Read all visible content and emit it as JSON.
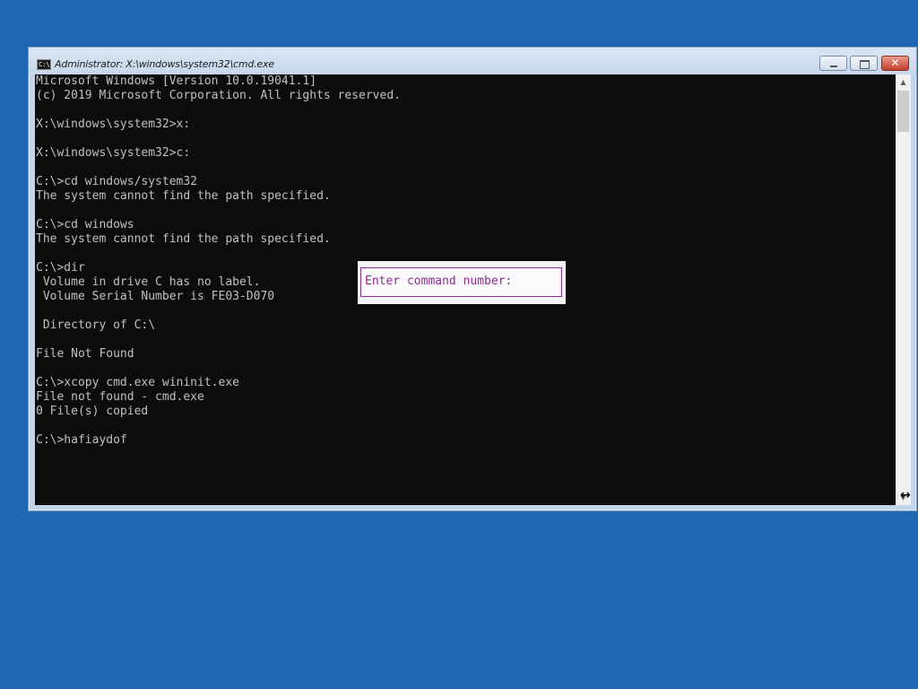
{
  "window": {
    "title": "Administrator: X:\\windows\\system32\\cmd.exe",
    "icon": "cmd-icon",
    "controls": {
      "minimize": "minimize-icon",
      "maximize": "maximize-icon",
      "close": "✕"
    }
  },
  "console": {
    "lines": [
      "Microsoft Windows [Version 10.0.19041.1]",
      "(c) 2019 Microsoft Corporation. All rights reserved.",
      "",
      "X:\\windows\\system32>x:",
      "",
      "X:\\windows\\system32>c:",
      "",
      "C:\\>cd windows/system32",
      "The system cannot find the path specified.",
      "",
      "C:\\>cd windows",
      "The system cannot find the path specified.",
      "",
      "C:\\>dir",
      " Volume in drive C has no label.",
      " Volume Serial Number is FE03-D070",
      "",
      " Directory of C:\\",
      "",
      "File Not Found",
      "",
      "C:\\>xcopy cmd.exe wininit.exe",
      "File not found - cmd.exe",
      "0 File(s) copied",
      "",
      "C:\\>hafiaydof"
    ]
  },
  "popup": {
    "label": "Enter command number:"
  },
  "colors": {
    "desktop": "#1f67b1",
    "console_bg": "#0c0c0c",
    "console_text": "#c0c0c0",
    "popup_text": "#8a2c8c"
  }
}
